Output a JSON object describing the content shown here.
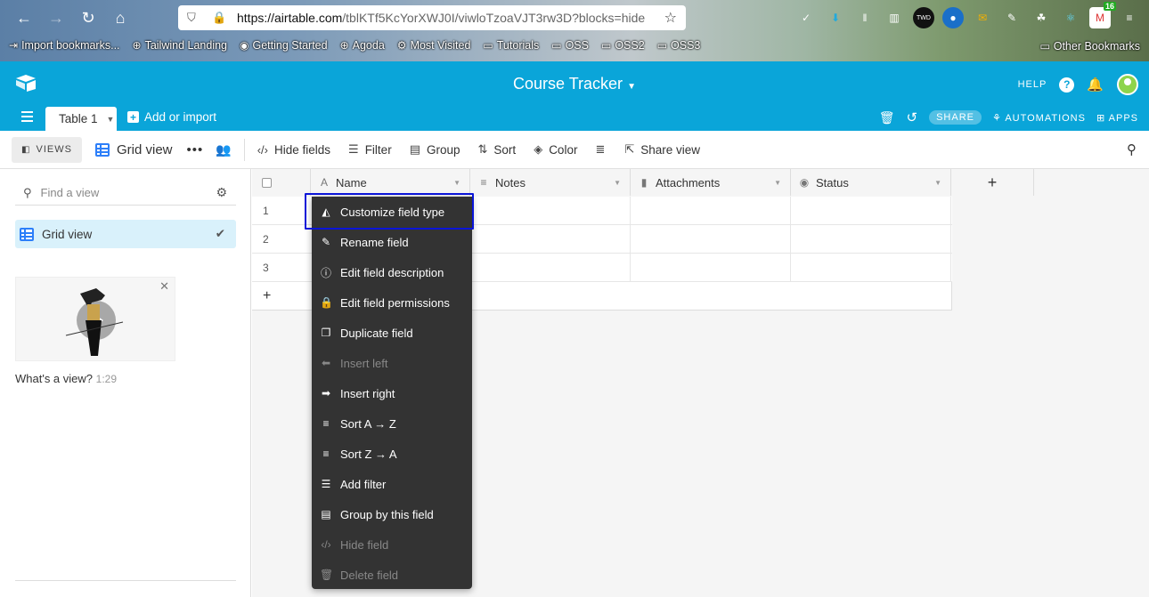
{
  "browser": {
    "url_host": "https://airtable.com",
    "url_path": "/tblKTf5KcYorXWJ0I/viwloTzoaVJT3rw3D?blocks=hide",
    "bookmarks": [
      "Import bookmarks...",
      "Tailwind Landing",
      "Getting Started",
      "Agoda",
      "Most Visited",
      "Tutorials",
      "OSS",
      "OSS2",
      "OSS3"
    ],
    "other_bookmarks": "Other Bookmarks",
    "badge_count": "16"
  },
  "header": {
    "base_title": "Course Tracker",
    "help": "HELP",
    "help_q": "?"
  },
  "tabs": {
    "table_tab": "Table 1",
    "add_import": "Add or import",
    "share": "SHARE",
    "automations": "AUTOMATIONS",
    "apps": "APPS"
  },
  "viewbar": {
    "views": "VIEWS",
    "current_view": "Grid view",
    "hide_fields": "Hide fields",
    "filter": "Filter",
    "group": "Group",
    "sort": "Sort",
    "color": "Color",
    "share_view": "Share view"
  },
  "sidebar": {
    "find_placeholder": "Find a view",
    "view_item": "Grid view",
    "video_caption": "What's a view?",
    "video_duration": "1:29"
  },
  "grid": {
    "columns": [
      "Name",
      "Notes",
      "Attachments",
      "Status"
    ],
    "row_numbers": [
      "1",
      "2",
      "3"
    ],
    "add_row": "+",
    "add_field": "+"
  },
  "context_menu": {
    "items": [
      {
        "label": "Customize field type",
        "icon": "shapes-icon",
        "disabled": false
      },
      {
        "label": "Rename field",
        "icon": "pencil-icon",
        "disabled": false
      },
      {
        "label": "Edit field description",
        "icon": "info-icon",
        "disabled": false
      },
      {
        "label": "Edit field permissions",
        "icon": "lock-icon",
        "disabled": false
      },
      {
        "label": "Duplicate field",
        "icon": "duplicate-icon",
        "disabled": false
      },
      {
        "label": "Insert left",
        "icon": "arrow-left-icon",
        "disabled": true
      },
      {
        "label": "Insert right",
        "icon": "arrow-right-icon",
        "disabled": false
      },
      {
        "label": "Sort A → Z",
        "icon": "sort-asc-icon",
        "disabled": false
      },
      {
        "label": "Sort Z → A",
        "icon": "sort-desc-icon",
        "disabled": false
      },
      {
        "label": "Add filter",
        "icon": "filter-icon",
        "disabled": false
      },
      {
        "label": "Group by this field",
        "icon": "group-icon",
        "disabled": false
      },
      {
        "label": "Hide field",
        "icon": "hide-icon",
        "disabled": true
      },
      {
        "label": "Delete field",
        "icon": "trash-icon",
        "disabled": true
      }
    ]
  },
  "colors": {
    "brand": "#0aa5d9",
    "menu_bg": "#333333",
    "highlight_border": "#0a14d8",
    "selected_view_bg": "#d9f1fb"
  }
}
